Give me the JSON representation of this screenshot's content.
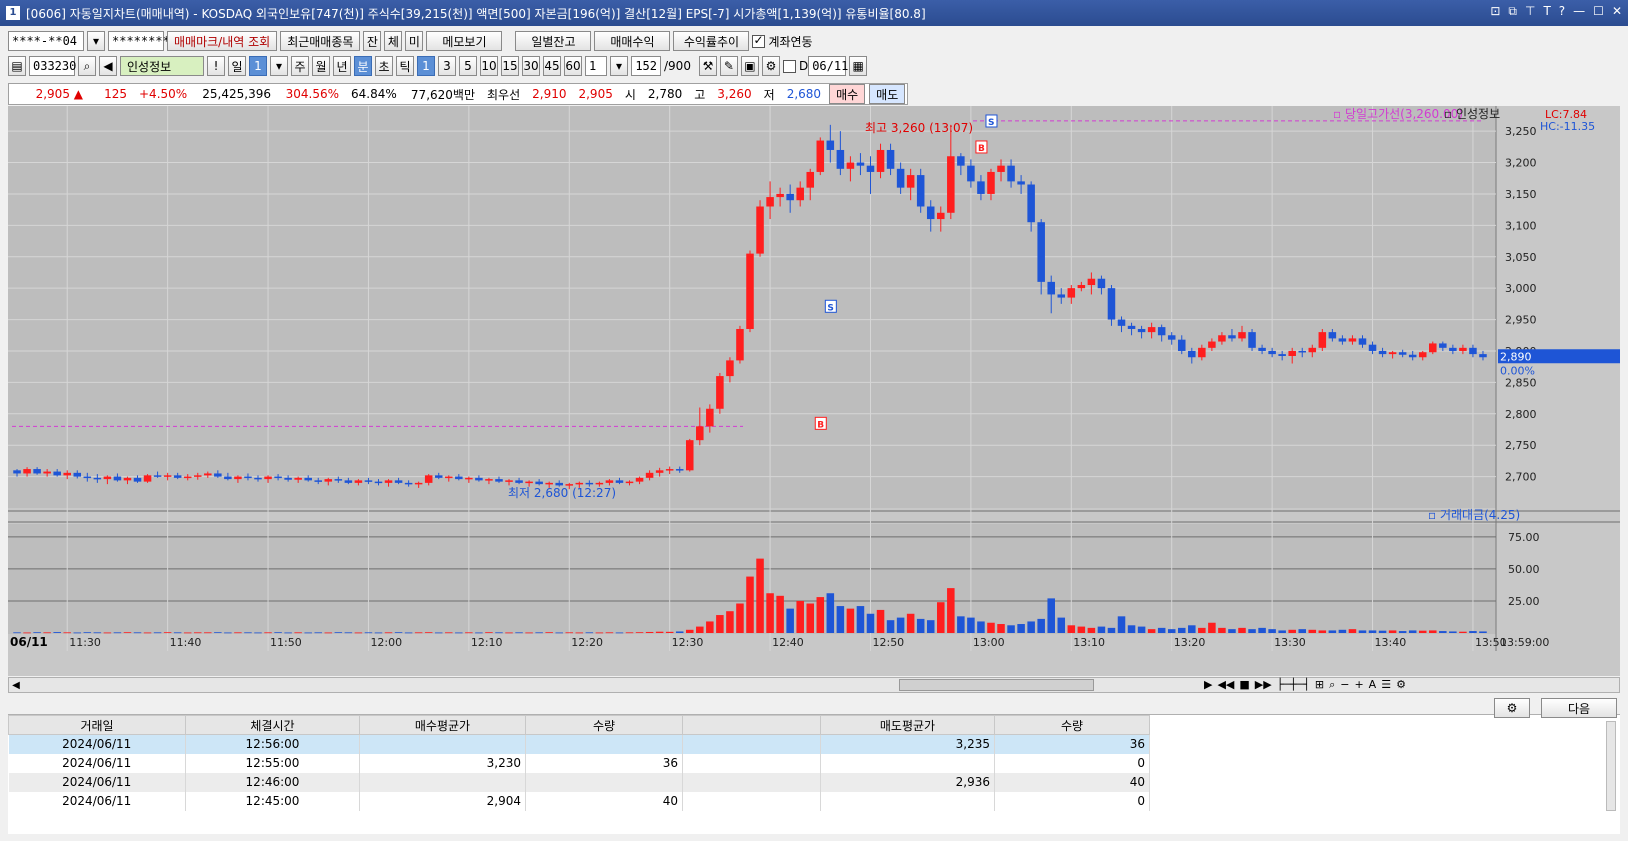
{
  "window": {
    "title": "[0606] 자동일지차트(매매내역) - KOSDAQ 외국인보유[747(천)] 주식수[39,215(천)] 액면[500] 자본금[196(억)] 결산[12월] EPS[-7] 시가총액[1,139(억)] 유통비율[80.8]",
    "icon_label": "1"
  },
  "toolbar1": {
    "account": "****-**04",
    "password": "********",
    "trade_mark_btn": "매매마크/내역 조회",
    "recent_btn": "최근매매종목",
    "jan": "잔",
    "che": "체",
    "mi": "미",
    "memo_btn": "메모보기",
    "daily_btn": "일별잔고",
    "profit_btn": "매매수익",
    "return_btn": "수익률추이",
    "link_label": "계좌연동"
  },
  "toolbar2": {
    "code": "033230",
    "name": "인성정보",
    "periods": [
      "일",
      "1"
    ],
    "units": [
      "주",
      "월",
      "년",
      "분",
      "초",
      "틱"
    ],
    "minutes": [
      "1",
      "3",
      "5",
      "10",
      "15",
      "30",
      "45",
      "60"
    ],
    "multiplier": "1",
    "count": "152",
    "count_max": "/900",
    "d_label": "D",
    "date": "06/11"
  },
  "infobar": {
    "price": "2,905 ▲",
    "change": "125",
    "change_pct": "+4.50%",
    "volume": "25,425,396",
    "vol_ratio": "304.56%",
    "turnover": "64.84%",
    "amount": "77,620백만",
    "best_label": "최우선",
    "ask": "2,910",
    "bid": "2,905",
    "open_label": "시",
    "open": "2,780",
    "high_label": "고",
    "high": "3,260",
    "low_label": "저",
    "low": "2,680",
    "buy_btn": "매수",
    "sell_btn": "매도"
  },
  "chart": {
    "legend_high": "당일고가선(3,260.00)",
    "legend_name": "인성정보",
    "lc": "LC:7.84",
    "hc": "HC:-11.35",
    "high_label": "최고 3,260 (13:07)",
    "low_label": "최저 2,680 (12:27)",
    "current": "2,890",
    "current_pct": "0.00%",
    "vol_legend": "거래대금(4.25)",
    "date_label": "06/11",
    "end_time": "13:59:00"
  },
  "chart_data": {
    "type": "candlestick",
    "price_axis": [
      "3,250",
      "3,200",
      "3,150",
      "3,100",
      "3,050",
      "3,000",
      "2,950",
      "2,900",
      "2,850",
      "2,800",
      "2,750",
      "2,700"
    ],
    "ylim": [
      2650,
      3290
    ],
    "time_axis": [
      "11:30",
      "11:40",
      "11:50",
      "12:00",
      "12:10",
      "12:20",
      "12:30",
      "12:40",
      "12:50",
      "13:00",
      "13:10",
      "13:20",
      "13:30",
      "13:40",
      "13:50"
    ],
    "volume_axis": [
      "75.00",
      "50.00",
      "25.00"
    ],
    "candles": [
      [
        2710,
        2712,
        2700,
        2705
      ],
      [
        2705,
        2715,
        2700,
        2712
      ],
      [
        2712,
        2715,
        2703,
        2705
      ],
      [
        2705,
        2712,
        2700,
        2708
      ],
      [
        2708,
        2712,
        2700,
        2702
      ],
      [
        2702,
        2710,
        2696,
        2706
      ],
      [
        2706,
        2710,
        2697,
        2700
      ],
      [
        2700,
        2706,
        2692,
        2698
      ],
      [
        2698,
        2704,
        2690,
        2696
      ],
      [
        2696,
        2702,
        2688,
        2700
      ],
      [
        2700,
        2705,
        2692,
        2694
      ],
      [
        2694,
        2700,
        2688,
        2698
      ],
      [
        2698,
        2702,
        2690,
        2692
      ],
      [
        2692,
        2704,
        2690,
        2702
      ],
      [
        2702,
        2708,
        2698,
        2700
      ],
      [
        2700,
        2706,
        2694,
        2702
      ],
      [
        2702,
        2706,
        2696,
        2698
      ],
      [
        2698,
        2704,
        2694,
        2700
      ],
      [
        2700,
        2706,
        2695,
        2702
      ],
      [
        2702,
        2708,
        2698,
        2705
      ],
      [
        2705,
        2710,
        2698,
        2700
      ],
      [
        2700,
        2706,
        2694,
        2696
      ],
      [
        2696,
        2702,
        2690,
        2700
      ],
      [
        2700,
        2705,
        2694,
        2698
      ],
      [
        2698,
        2702,
        2692,
        2696
      ],
      [
        2696,
        2702,
        2690,
        2700
      ],
      [
        2700,
        2704,
        2694,
        2698
      ],
      [
        2698,
        2702,
        2692,
        2695
      ],
      [
        2695,
        2700,
        2690,
        2698
      ],
      [
        2698,
        2702,
        2692,
        2694
      ],
      [
        2694,
        2698,
        2688,
        2692
      ],
      [
        2692,
        2698,
        2686,
        2696
      ],
      [
        2696,
        2700,
        2690,
        2694
      ],
      [
        2694,
        2698,
        2688,
        2690
      ],
      [
        2690,
        2696,
        2686,
        2694
      ],
      [
        2694,
        2698,
        2688,
        2692
      ],
      [
        2692,
        2696,
        2686,
        2690
      ],
      [
        2690,
        2696,
        2684,
        2694
      ],
      [
        2694,
        2698,
        2688,
        2690
      ],
      [
        2690,
        2694,
        2684,
        2688
      ],
      [
        2688,
        2692,
        2682,
        2690
      ],
      [
        2690,
        2704,
        2686,
        2702
      ],
      [
        2702,
        2706,
        2696,
        2698
      ],
      [
        2698,
        2702,
        2692,
        2700
      ],
      [
        2700,
        2704,
        2694,
        2696
      ],
      [
        2696,
        2700,
        2690,
        2698
      ],
      [
        2698,
        2702,
        2692,
        2694
      ],
      [
        2694,
        2698,
        2688,
        2696
      ],
      [
        2696,
        2700,
        2690,
        2692
      ],
      [
        2692,
        2696,
        2686,
        2694
      ],
      [
        2694,
        2698,
        2688,
        2690
      ],
      [
        2690,
        2694,
        2684,
        2692
      ],
      [
        2692,
        2696,
        2686,
        2688
      ],
      [
        2688,
        2692,
        2682,
        2690
      ],
      [
        2690,
        2694,
        2684,
        2686
      ],
      [
        2686,
        2690,
        2680,
        2688
      ],
      [
        2688,
        2692,
        2682,
        2690
      ],
      [
        2690,
        2694,
        2684,
        2688
      ],
      [
        2688,
        2692,
        2684,
        2690
      ],
      [
        2690,
        2696,
        2686,
        2694
      ],
      [
        2694,
        2698,
        2688,
        2690
      ],
      [
        2690,
        2694,
        2686,
        2692
      ],
      [
        2692,
        2700,
        2688,
        2698
      ],
      [
        2698,
        2710,
        2694,
        2706
      ],
      [
        2706,
        2714,
        2700,
        2710
      ],
      [
        2710,
        2716,
        2704,
        2712
      ],
      [
        2712,
        2716,
        2706,
        2710
      ],
      [
        2710,
        2760,
        2708,
        2758
      ],
      [
        2758,
        2810,
        2750,
        2780
      ],
      [
        2780,
        2815,
        2770,
        2808
      ],
      [
        2808,
        2865,
        2800,
        2860
      ],
      [
        2860,
        2890,
        2850,
        2885
      ],
      [
        2885,
        2940,
        2880,
        2935
      ],
      [
        2935,
        3060,
        2930,
        3055
      ],
      [
        3055,
        3140,
        3050,
        3130
      ],
      [
        3130,
        3170,
        3110,
        3145
      ],
      [
        3145,
        3160,
        3130,
        3150
      ],
      [
        3150,
        3165,
        3120,
        3140
      ],
      [
        3140,
        3170,
        3130,
        3160
      ],
      [
        3160,
        3190,
        3140,
        3185
      ],
      [
        3185,
        3240,
        3180,
        3235
      ],
      [
        3235,
        3260,
        3200,
        3220
      ],
      [
        3220,
        3250,
        3180,
        3190
      ],
      [
        3190,
        3210,
        3170,
        3200
      ],
      [
        3200,
        3215,
        3180,
        3195
      ],
      [
        3195,
        3210,
        3150,
        3185
      ],
      [
        3185,
        3230,
        3175,
        3220
      ],
      [
        3220,
        3230,
        3180,
        3190
      ],
      [
        3190,
        3200,
        3150,
        3160
      ],
      [
        3160,
        3190,
        3140,
        3180
      ],
      [
        3180,
        3190,
        3120,
        3130
      ],
      [
        3130,
        3140,
        3090,
        3110
      ],
      [
        3110,
        3130,
        3090,
        3120
      ],
      [
        3120,
        3260,
        3110,
        3210
      ],
      [
        3210,
        3215,
        3180,
        3195
      ],
      [
        3195,
        3205,
        3160,
        3170
      ],
      [
        3170,
        3180,
        3140,
        3150
      ],
      [
        3150,
        3190,
        3140,
        3185
      ],
      [
        3185,
        3205,
        3170,
        3195
      ],
      [
        3195,
        3205,
        3160,
        3170
      ],
      [
        3170,
        3180,
        3150,
        3165
      ],
      [
        3165,
        3170,
        3090,
        3105
      ],
      [
        3105,
        3110,
        2990,
        3010
      ],
      [
        3010,
        3020,
        2960,
        2990
      ],
      [
        2990,
        3000,
        2975,
        2985
      ],
      [
        2985,
        3005,
        2975,
        3000
      ],
      [
        3000,
        3010,
        2995,
        3005
      ],
      [
        3005,
        3025,
        2990,
        3015
      ],
      [
        3015,
        3020,
        2990,
        3000
      ],
      [
        3000,
        3005,
        2940,
        2950
      ],
      [
        2950,
        2955,
        2930,
        2940
      ],
      [
        2940,
        2945,
        2925,
        2935
      ],
      [
        2935,
        2940,
        2920,
        2930
      ],
      [
        2930,
        2945,
        2920,
        2938
      ],
      [
        2938,
        2942,
        2915,
        2925
      ],
      [
        2925,
        2930,
        2910,
        2918
      ],
      [
        2918,
        2925,
        2895,
        2900
      ],
      [
        2900,
        2905,
        2880,
        2890
      ],
      [
        2890,
        2910,
        2885,
        2905
      ],
      [
        2905,
        2920,
        2900,
        2915
      ],
      [
        2915,
        2930,
        2910,
        2925
      ],
      [
        2925,
        2935,
        2915,
        2920
      ],
      [
        2920,
        2940,
        2915,
        2930
      ],
      [
        2930,
        2935,
        2900,
        2905
      ],
      [
        2905,
        2910,
        2895,
        2900
      ],
      [
        2900,
        2905,
        2890,
        2895
      ],
      [
        2895,
        2900,
        2885,
        2892
      ],
      [
        2892,
        2905,
        2880,
        2900
      ],
      [
        2900,
        2905,
        2890,
        2898
      ],
      [
        2898,
        2910,
        2890,
        2905
      ],
      [
        2905,
        2935,
        2900,
        2930
      ],
      [
        2930,
        2935,
        2915,
        2920
      ],
      [
        2920,
        2925,
        2910,
        2915
      ],
      [
        2915,
        2925,
        2910,
        2920
      ],
      [
        2920,
        2925,
        2905,
        2910
      ],
      [
        2910,
        2915,
        2895,
        2900
      ],
      [
        2900,
        2905,
        2890,
        2895
      ],
      [
        2895,
        2900,
        2888,
        2898
      ],
      [
        2898,
        2902,
        2890,
        2894
      ],
      [
        2894,
        2900,
        2885,
        2890
      ],
      [
        2890,
        2900,
        2885,
        2898
      ],
      [
        2898,
        2915,
        2895,
        2912
      ],
      [
        2912,
        2915,
        2900,
        2905
      ],
      [
        2905,
        2910,
        2895,
        2900
      ],
      [
        2900,
        2910,
        2895,
        2905
      ],
      [
        2905,
        2910,
        2890,
        2895
      ],
      [
        2895,
        2900,
        2885,
        2890
      ]
    ],
    "volumes": [
      0.5,
      0.4,
      0.6,
      0.5,
      0.7,
      0.5,
      0.4,
      0.6,
      0.5,
      0.4,
      0.5,
      0.6,
      0.5,
      0.4,
      0.5,
      0.6,
      0.5,
      0.4,
      0.5,
      0.5,
      0.6,
      0.4,
      0.5,
      0.5,
      0.4,
      0.5,
      0.6,
      0.4,
      0.5,
      0.4,
      0.5,
      0.4,
      0.6,
      0.5,
      0.4,
      0.5,
      0.4,
      0.5,
      0.6,
      0.4,
      0.5,
      0.6,
      0.4,
      0.5,
      0.4,
      0.5,
      0.4,
      0.6,
      0.5,
      0.4,
      0.5,
      0.4,
      0.5,
      0.6,
      0.4,
      0.5,
      0.4,
      0.5,
      0.4,
      0.5,
      0.4,
      0.5,
      0.6,
      0.8,
      1.0,
      0.9,
      1.2,
      2.5,
      5.0,
      9.0,
      14.0,
      17.0,
      23.0,
      44.0,
      58.0,
      31.0,
      29.0,
      19.0,
      25.0,
      23.0,
      28.0,
      31.0,
      21.0,
      19.0,
      21.0,
      15.0,
      18.0,
      10.0,
      12.0,
      15.0,
      11.0,
      10.0,
      24.0,
      35.0,
      13.0,
      12.0,
      9.0,
      8.0,
      7.0,
      6.0,
      7.0,
      9.0,
      11.0,
      27.0,
      12.0,
      6.0,
      5.0,
      4.0,
      5.0,
      4.0,
      13.0,
      6.0,
      5.0,
      3.0,
      4.0,
      3.0,
      4.0,
      6.0,
      4.0,
      8.0,
      4.0,
      3.0,
      4.0,
      3.0,
      4.0,
      3.0,
      2.0,
      2.5,
      3.0,
      2.5,
      2.0,
      2.0,
      2.5,
      3.0,
      2.0,
      2.0,
      1.8,
      2.0,
      1.5,
      2.0,
      1.8,
      2.0,
      1.5,
      1.2,
      1.0,
      1.5,
      1.2,
      1.0,
      1.2
    ],
    "vol_ylim": [
      0,
      85
    ]
  },
  "scrollbar": {
    "left_arrow": "◀"
  },
  "bottom_table": {
    "gear": "⚙",
    "next_btn": "다음",
    "headers": [
      "거래일",
      "체결시간",
      "매수평균가",
      "수량",
      "",
      "매도평균가",
      "수량"
    ],
    "rows": [
      [
        "2024/06/11",
        "12:56:00",
        "",
        "",
        "",
        "3,235",
        "36"
      ],
      [
        "2024/06/11",
        "12:55:00",
        "3,230",
        "36",
        "",
        "",
        "0"
      ],
      [
        "2024/06/11",
        "12:46:00",
        "",
        "",
        "",
        "2,936",
        "40"
      ],
      [
        "2024/06/11",
        "12:45:00",
        "2,904",
        "40",
        "",
        "",
        "0"
      ]
    ]
  },
  "colors": {
    "up": "#ff1e1e",
    "down": "#1e55d6",
    "bg": "#c8c8c8",
    "title": "#2b4c90",
    "high_line": "#d23cd2"
  }
}
